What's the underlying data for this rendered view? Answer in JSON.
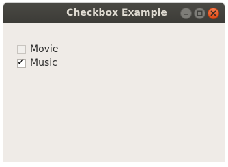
{
  "window": {
    "title": "Checkbox Example",
    "controls": {
      "minimize_icon": "minimize-icon",
      "maximize_icon": "maximize-icon",
      "close_icon": "close-icon"
    }
  },
  "checkboxes": [
    {
      "label": "Movie",
      "checked": false
    },
    {
      "label": "Music",
      "checked": true
    }
  ],
  "colors": {
    "titlebar": "#3c3b37",
    "title_text": "#dfdbd2",
    "window_bg": "#efebe7",
    "close_button": "#e9541c"
  }
}
